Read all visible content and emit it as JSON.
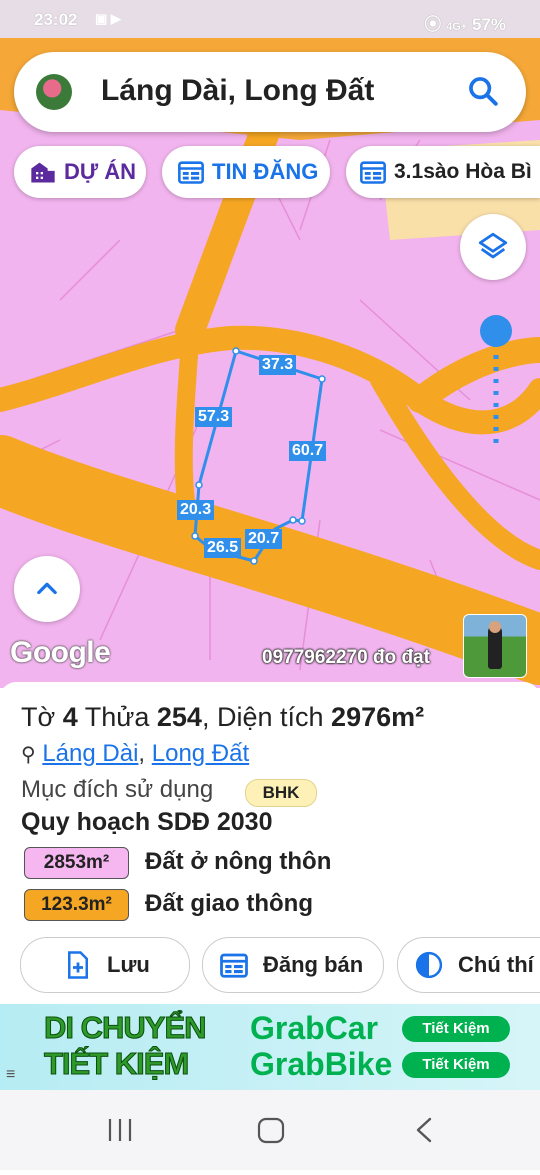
{
  "status": {
    "time": "23:02",
    "signal": "4G+",
    "battery": "57%"
  },
  "search": {
    "text": "Láng Dài, Long Đất"
  },
  "chips": [
    {
      "label": "DỰ ÁN",
      "color": "#5b2a9e"
    },
    {
      "label": "TIN ĐĂNG",
      "color": "#1a73e8"
    },
    {
      "label": "3.1sào Hòa Bì"
    }
  ],
  "map": {
    "edges": [
      "37.3",
      "60.7",
      "20.7",
      "26.5",
      "20.3",
      "57.3"
    ],
    "brand": "Google",
    "contact": "0977962270 đo đạt"
  },
  "parcel": {
    "sheet_label": "Tờ",
    "sheet": "4",
    "lot_label": "Thửa",
    "lot": "254",
    "area_label": "Diện tích",
    "area": "2976m²",
    "commune": "Láng Dài",
    "district": "Long Đất",
    "purpose_label": "Mục đích sử dụng",
    "purpose_code": "BHK",
    "plan_title": "Quy hoạch SDĐ 2030",
    "zones": [
      {
        "area": "2853m²",
        "label": "Đất ở nông thôn",
        "color": "#f6b6f0"
      },
      {
        "area": "123.3m²",
        "label": "Đất giao thông",
        "color": "#f5a623"
      }
    ]
  },
  "actions": [
    {
      "label": "Lưu"
    },
    {
      "label": "Đăng bán"
    },
    {
      "label": "Chú thí"
    }
  ],
  "ad": {
    "line1": "DI CHUYỂN",
    "line2": "TIẾT KIỆM",
    "brand1": "GrabCar",
    "brand2": "GrabBike",
    "pill": "Tiết Kiệm"
  },
  "colors": {
    "land": "#f2b4ee",
    "road": "#f5a623",
    "parcel": "#2f8fea"
  }
}
